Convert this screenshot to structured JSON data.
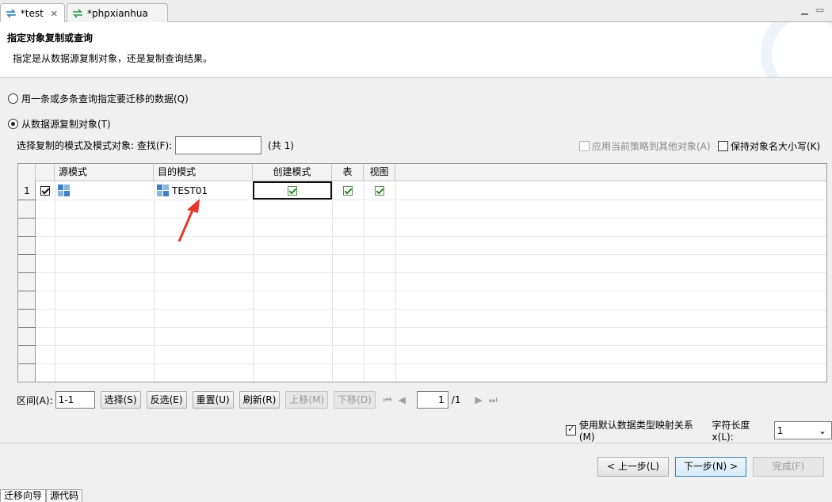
{
  "tabs": [
    {
      "label": "*test",
      "active": true
    },
    {
      "label": "*phpxianhua",
      "active": false
    }
  ],
  "banner": {
    "title": "指定对象复制或查询",
    "description": "指定是从数据源复制对象，还是复制查询结果。"
  },
  "options": {
    "query_label": "用一条或多条查询指定要迁移的数据(Q)",
    "copy_label": "从数据源复制对象(T)"
  },
  "find": {
    "label": "选择复制的模式及模式对象: 查找(F):",
    "value": "",
    "total": "(共 1)"
  },
  "apply_policy_label": "应用当前策略到其他对象(A)",
  "keep_case_label": "保持对象名大小写(K)",
  "grid": {
    "headers": [
      "源模式",
      "目的模式",
      "创建模式",
      "表",
      "视图"
    ],
    "rows": [
      {
        "num": "1",
        "checked": true,
        "source": "",
        "dest": "TEST01",
        "create": true,
        "table": true,
        "view": true
      }
    ]
  },
  "controls": {
    "range_label": "区间(A):",
    "range_value": "1-1",
    "select": "选择(S)",
    "invert": "反选(E)",
    "reset": "重置(U)",
    "refresh": "刷新(R)",
    "up": "上移(M)",
    "down": "下移(D)",
    "page": "1",
    "page_total": "/1"
  },
  "mapping": {
    "label": "使用默认数据类型映射关系(M)",
    "length_label": "字符长度x(L):",
    "length_value": "1"
  },
  "footer": {
    "prev": "< 上一步(L)",
    "next": "下一步(N) >",
    "finish": "完成(F)"
  },
  "bottom_tabs": [
    "迁移向导",
    "源代码"
  ],
  "colors": {
    "accent": "#3c7fb1",
    "check": "#2a8a2a",
    "arrow": "#e8362b"
  }
}
